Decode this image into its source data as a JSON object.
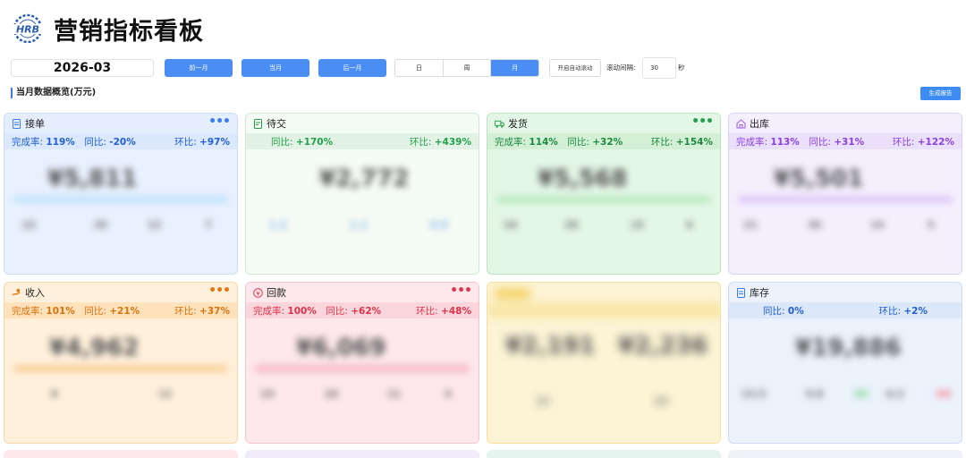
{
  "header": {
    "title": "营销指标看板",
    "logo_text": "HRB"
  },
  "toolbar": {
    "date": "2026-03",
    "prev_month": "前一月",
    "current_month": "当月",
    "next_month": "后一月",
    "segments": [
      "日",
      "周",
      "月"
    ],
    "selected_segment": "月",
    "auto_scroll": "开启自动滚动",
    "scroll_interval_label": "滚动间隔:",
    "scroll_interval_value": "30",
    "scroll_interval_unit": "秒"
  },
  "section": {
    "title": "当月数据概览(万元)",
    "generate_report": "生成报告"
  },
  "colors": {
    "accent": "#4a8ef5",
    "positive_green": "#22a04a",
    "negative_blue": "#1f5fd1"
  },
  "cards": [
    {
      "name": "接单",
      "icon": "document-icon",
      "stats": [
        {
          "label": "完成率:",
          "value": "119%"
        },
        {
          "label": "同比:",
          "value": "-20%"
        },
        {
          "label": "环比:",
          "value": "+97%"
        }
      ],
      "blurred_big": "¥5,811"
    },
    {
      "name": "待交",
      "icon": "pending-icon",
      "stats": [
        {
          "label": "同比:",
          "value": "+170%"
        },
        {
          "label": "环比:",
          "value": "+439%"
        }
      ],
      "blurred_big": "¥2,772"
    },
    {
      "name": "发货",
      "icon": "truck-icon",
      "stats": [
        {
          "label": "完成率:",
          "value": "114%"
        },
        {
          "label": "同比:",
          "value": "+32%"
        },
        {
          "label": "环比:",
          "value": "+154%"
        }
      ],
      "blurred_big": "¥5,568"
    },
    {
      "name": "出库",
      "icon": "warehouse-icon",
      "stats": [
        {
          "label": "完成率:",
          "value": "113%"
        },
        {
          "label": "同比:",
          "value": "+31%"
        },
        {
          "label": "环比:",
          "value": "+122%"
        }
      ],
      "blurred_big": "¥5,501"
    },
    {
      "name": "收入",
      "icon": "income-icon",
      "stats": [
        {
          "label": "完成率:",
          "value": "101%"
        },
        {
          "label": "同比:",
          "value": "+21%"
        },
        {
          "label": "环比:",
          "value": "+37%"
        }
      ],
      "blurred_big": "¥4,962"
    },
    {
      "name": "回款",
      "icon": "yen-icon",
      "stats": [
        {
          "label": "完成率:",
          "value": "100%"
        },
        {
          "label": "同比:",
          "value": "+62%"
        },
        {
          "label": "环比:",
          "value": "+48%"
        }
      ],
      "blurred_big": "¥6,069"
    },
    {
      "name": "",
      "icon": "blurred-icon",
      "stats": [],
      "blurred_big": "¥2,191",
      "blurred_big2": "¥2,236"
    },
    {
      "name": "库存",
      "icon": "inventory-icon",
      "stats": [
        {
          "label": "同比:",
          "value": "0%"
        },
        {
          "label": "环比:",
          "value": "+2%"
        }
      ],
      "blurred_big": "¥19,886"
    }
  ]
}
